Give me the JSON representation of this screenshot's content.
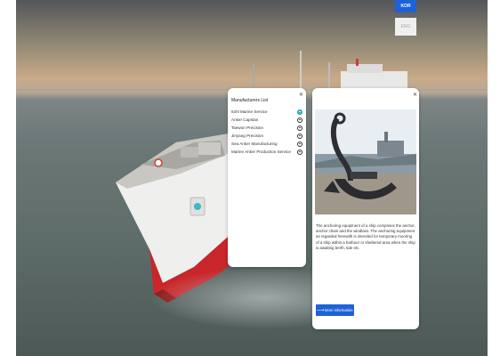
{
  "header": {
    "lang_active": "KOR",
    "lang_inactive": "ENG"
  },
  "manufacturers": {
    "title": "Manufacturers List",
    "close_icon": "close-icon",
    "items": [
      {
        "label": "Itohl Marine Service",
        "selected": true
      },
      {
        "label": "Anker Capstan",
        "selected": false
      },
      {
        "label": "Taewon Precision",
        "selected": false
      },
      {
        "label": "Jinyang Precision",
        "selected": false
      },
      {
        "label": "Sea Anker Manufacturing",
        "selected": false
      },
      {
        "label": "Marine Anker Production Service",
        "selected": false
      }
    ]
  },
  "info": {
    "close_icon": "close-icon",
    "image": "anchor-photo",
    "description": "The anchoring equipment of a ship comprises the anchor, anchor chain and the windlass. The anchoring equipment as regarded herewith is intended for temporary mooring of a ship within a harbour or sheltered area when the ship is awaiting berth, tide etc.",
    "more_button": "More information",
    "more_icon": "arrow-right-icon"
  },
  "colors": {
    "accent": "#1e62d8",
    "selected": "#35b8b8",
    "hull_red": "#c8262a"
  }
}
